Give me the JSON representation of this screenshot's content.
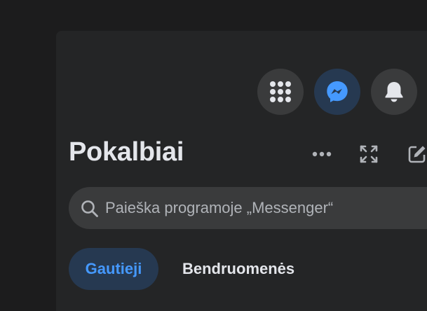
{
  "header": {
    "buttons": [
      {
        "icon": "menu-grid-icon"
      },
      {
        "icon": "messenger-icon",
        "active": true
      },
      {
        "icon": "bell-icon"
      }
    ]
  },
  "chats": {
    "title": "Pokalbiai",
    "actions": [
      {
        "icon": "more-dots-icon"
      },
      {
        "icon": "expand-icon"
      },
      {
        "icon": "new-message-icon"
      }
    ],
    "search": {
      "placeholder": "Paieška programoje „Messenger“",
      "value": ""
    },
    "tabs": [
      {
        "label": "Gautieji",
        "active": true
      },
      {
        "label": "Bendruomenės",
        "active": false
      }
    ]
  },
  "colors": {
    "background": "#1c1c1d",
    "panel": "#242526",
    "button": "#3a3b3c",
    "accent": "#4599ff",
    "accent_bg": "#263951",
    "text": "#e4e6eb"
  }
}
